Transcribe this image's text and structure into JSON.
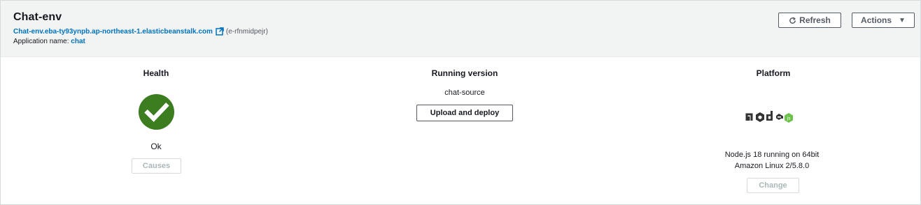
{
  "header": {
    "title": "Chat-env",
    "url": "Chat-env.eba-ty93ynpb.ap-northeast-1.elasticbeanstalk.com",
    "env_id": "(e-rfnmidpejr)",
    "app_label": "Application name:",
    "app_name": "chat",
    "refresh_label": "Refresh",
    "actions_label": "Actions",
    "refresh_icon": "refresh-icon",
    "actions_icon": "caret-down-icon",
    "external_link_icon": "external-link-icon"
  },
  "health": {
    "title": "Health",
    "status": "Ok",
    "status_icon": "check-circle-icon",
    "status_color": "#3b7d1f",
    "causes_label": "Causes"
  },
  "running_version": {
    "title": "Running version",
    "version": "chat-source",
    "upload_label": "Upload and deploy"
  },
  "platform": {
    "title": "Platform",
    "logo": "nodejs-logo",
    "description_line1": "Node.js 18 running on 64bit",
    "description_line2": "Amazon Linux 2/5.8.0",
    "change_label": "Change"
  },
  "colors": {
    "link": "#0073bb",
    "header_bg": "#f2f3f3",
    "success": "#3b7d1f"
  }
}
